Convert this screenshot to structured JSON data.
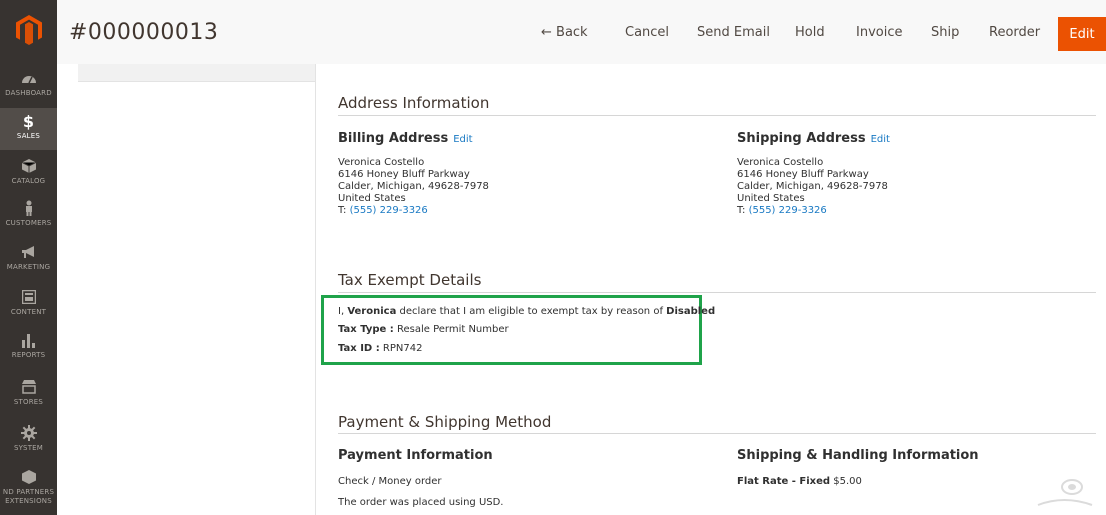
{
  "sidebar": {
    "items": [
      {
        "label": "DASHBOARD",
        "icon": "dashboard-icon"
      },
      {
        "label": "SALES",
        "icon": "dollar-icon",
        "active": true
      },
      {
        "label": "CATALOG",
        "icon": "cube-icon"
      },
      {
        "label": "CUSTOMERS",
        "icon": "person-icon"
      },
      {
        "label": "MARKETING",
        "icon": "megaphone-icon"
      },
      {
        "label": "CONTENT",
        "icon": "content-icon"
      },
      {
        "label": "REPORTS",
        "icon": "bar-chart-icon"
      },
      {
        "label": "STORES",
        "icon": "store-icon"
      },
      {
        "label": "SYSTEM",
        "icon": "gear-icon"
      },
      {
        "label": "ND PARTNERS EXTENSIONS",
        "label_line1": "ND PARTNERS",
        "label_line2": "EXTENSIONS",
        "icon": "puzzle-icon"
      }
    ]
  },
  "header": {
    "order_number": "#000000013",
    "back": "← Back",
    "cancel": "Cancel",
    "send_email": "Send Email",
    "hold": "Hold",
    "invoice": "Invoice",
    "ship": "Ship",
    "reorder": "Reorder",
    "edit": "Edit"
  },
  "address": {
    "title": "Address Information",
    "billing": {
      "heading": "Billing Address",
      "edit": "Edit",
      "name": "Veronica Costello",
      "street": "6146 Honey Bluff Parkway",
      "city": "Calder, Michigan, 49628-7978",
      "country": "United States",
      "phone_prefix": "T: ",
      "phone": "(555) 229-3326"
    },
    "shipping": {
      "heading": "Shipping Address",
      "edit": "Edit",
      "name": "Veronica Costello",
      "street": "6146 Honey Bluff Parkway",
      "city": "Calder, Michigan, 49628-7978",
      "country": "United States",
      "phone_prefix": "T: ",
      "phone": "(555) 229-3326"
    }
  },
  "tax": {
    "title": "Tax Exempt Details",
    "decl_prefix": "I, ",
    "decl_name": "Veronica",
    "decl_mid": " declare that I am eligible to exempt tax by reason of ",
    "decl_reason": "Disabled",
    "type_label": "Tax Type :",
    "type_value": " Resale Permit Number",
    "id_label": "Tax ID :",
    "id_value": " RPN742",
    "highlight_color": "#1fa34a"
  },
  "payment": {
    "title": "Payment & Shipping Method",
    "payment_heading": "Payment Information",
    "method": "Check / Money order",
    "currency_note": "The order was placed using USD.",
    "shipping_heading": "Shipping & Handling Information",
    "shipping_label": "Flat Rate - Fixed",
    "shipping_price": " $5.00"
  },
  "colors": {
    "sidebar": "#373330",
    "accent": "#eb5202",
    "link": "#1979c3"
  }
}
